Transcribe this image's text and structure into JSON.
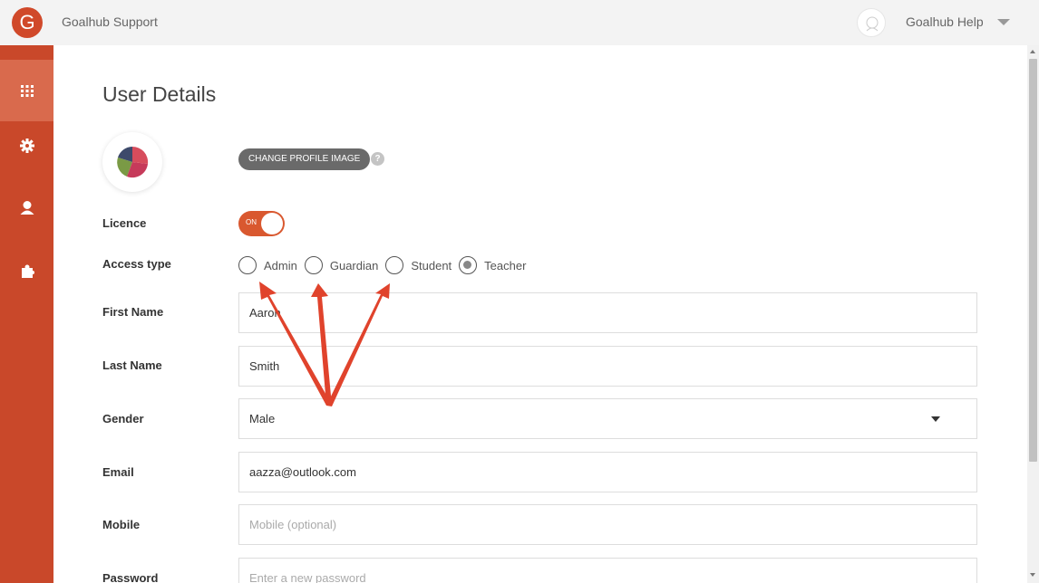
{
  "header": {
    "logo_letter": "G",
    "app_title": "Goalhub Support",
    "user_menu_label": "Goalhub Help"
  },
  "sidebar": {
    "items": [
      {
        "icon": "apps-grid-icon",
        "active": true
      },
      {
        "icon": "gear-icon",
        "active": false
      },
      {
        "icon": "user-icon",
        "active": false
      },
      {
        "icon": "puzzle-icon",
        "active": false
      }
    ]
  },
  "page": {
    "title": "User Details",
    "change_image_label": "CHANGE PROFILE IMAGE",
    "help_glyph": "?"
  },
  "form": {
    "licence": {
      "label": "Licence",
      "toggle_text": "ON",
      "value": true
    },
    "access_type": {
      "label": "Access type",
      "options": [
        "Admin",
        "Guardian",
        "Student",
        "Teacher"
      ],
      "selected": "Teacher"
    },
    "first_name": {
      "label": "First Name",
      "value": "Aaron"
    },
    "last_name": {
      "label": "Last Name",
      "value": "Smith"
    },
    "gender": {
      "label": "Gender",
      "value": "Male"
    },
    "email": {
      "label": "Email",
      "value": "aazza@outlook.com"
    },
    "mobile": {
      "label": "Mobile",
      "placeholder": "Mobile (optional)"
    },
    "password": {
      "label": "Password",
      "placeholder": "Enter a new password"
    }
  },
  "colors": {
    "accent": "#c9482a",
    "sidebar_active": "#d96a4d",
    "toggle_on": "#d9582f",
    "annotation_arrow": "#e0432c"
  }
}
